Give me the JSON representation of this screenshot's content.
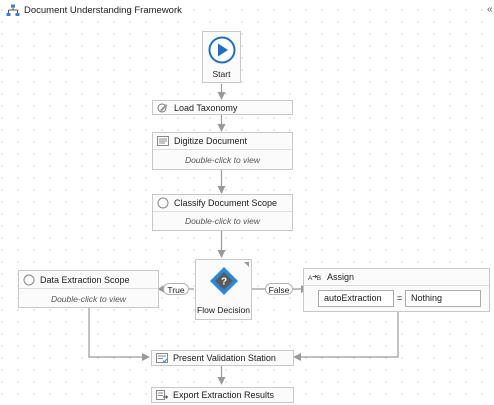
{
  "window": {
    "title": "Document Understanding Framework",
    "collapse_icon": "«"
  },
  "start": {
    "label": "Start"
  },
  "activities": {
    "load_taxonomy": {
      "label": "Load Taxonomy"
    },
    "digitize_document": {
      "label": "Digitize Document",
      "body": "Double-click to view"
    },
    "classify_document_scope": {
      "label": "Classify Document Scope",
      "body": "Double-click to view"
    },
    "data_extraction_scope": {
      "label": "Data Extraction Scope",
      "body": "Double-click to view"
    },
    "present_validation_station": {
      "label": "Present Validation Station"
    },
    "export_extraction_results": {
      "label": "Export Extraction Results"
    }
  },
  "decision": {
    "label": "Flow Decision",
    "true_label": "True",
    "false_label": "False"
  },
  "assign": {
    "label": "Assign",
    "to": "autoExtraction",
    "operator": "=",
    "value": "Nothing"
  },
  "colors": {
    "start_blue": "#1f6fc1",
    "decision_blue": "#2a88d8",
    "connector": "#9a9a9a"
  }
}
